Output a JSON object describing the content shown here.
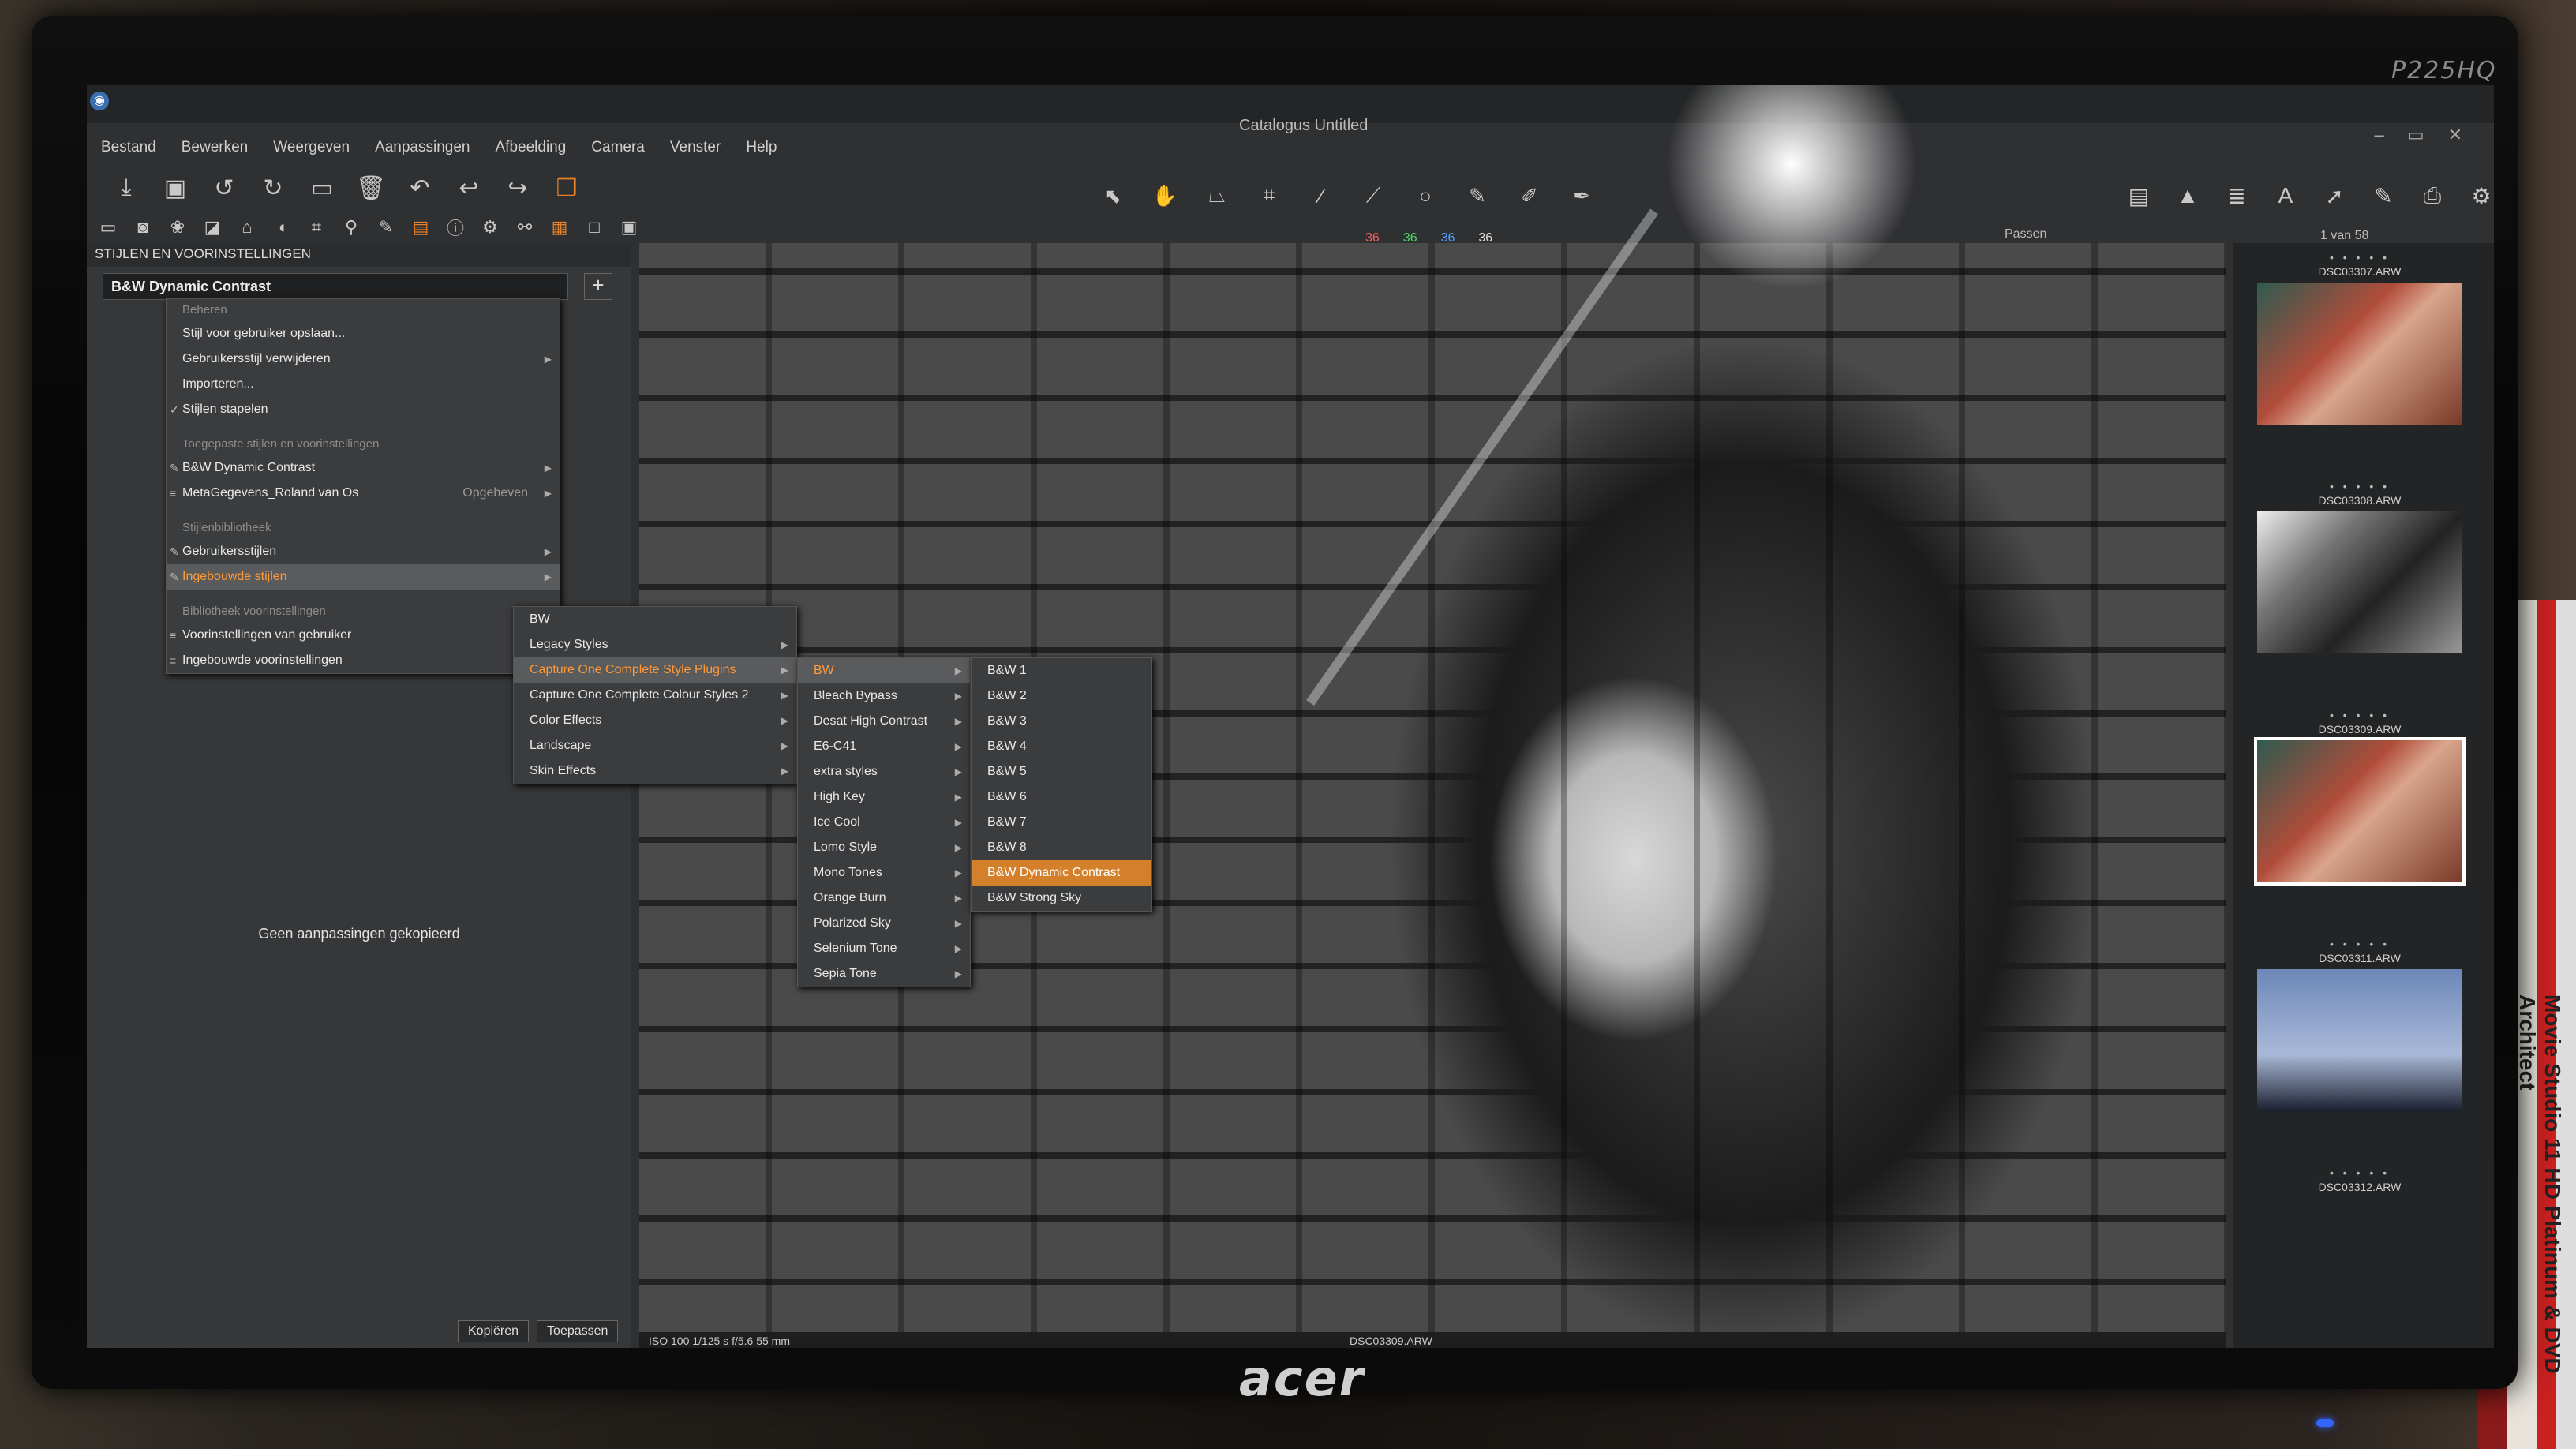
{
  "window": {
    "title": "Catalogus Untitled",
    "controls": [
      "–",
      "▭",
      "✕"
    ]
  },
  "menubar": [
    "Bestand",
    "Bewerken",
    "Weergeven",
    "Aanpassingen",
    "Afbeelding",
    "Camera",
    "Venster",
    "Help"
  ],
  "counts": {
    "red": "36",
    "green": "36",
    "blue": "36",
    "white": "36"
  },
  "passen_label": "Passen",
  "image_count": "1 van 58",
  "left_panel": {
    "header": "STIJLEN EN VOORINSTELLINGEN",
    "selected_style": "B&W Dynamic Contrast",
    "no_adjustments": "Geen aanpassingen gekopieerd",
    "copy_button": "Kopiëren",
    "apply_button": "Toepassen"
  },
  "menu1": {
    "section_manage": "Beheren",
    "save_style": "Stijl voor gebruiker opslaan...",
    "delete_style": "Gebruikersstijl verwijderen",
    "import": "Importeren...",
    "stack_styles": "Stijlen stapelen",
    "section_applied": "Toegepaste stijlen en voorinstellingen",
    "applied_1": "B&W Dynamic Contrast",
    "applied_2": "MetaGegevens_Roland van Os",
    "applied_2_suffix": "Opgeheven",
    "section_library": "Stijlenbibliotheek",
    "user_styles": "Gebruikersstijlen",
    "builtin_styles": "Ingebouwde stijlen",
    "section_presets": "Bibliotheek voorinstellingen",
    "user_presets": "Voorinstellingen van gebruiker",
    "builtin_presets": "Ingebouwde voorinstellingen"
  },
  "menu2": [
    "BW",
    "Legacy Styles",
    "Capture One Complete Style Plugins",
    "Capture One Complete Colour Styles 2",
    "Color Effects",
    "Landscape",
    "Skin Effects"
  ],
  "menu3": [
    "BW",
    "Bleach Bypass",
    "Desat High Contrast",
    "E6-C41",
    "extra styles",
    "High Key",
    "Ice Cool",
    "Lomo Style",
    "Mono Tones",
    "Orange Burn",
    "Polarized Sky",
    "Selenium Tone",
    "Sepia Tone"
  ],
  "menu4": [
    "B&W 1",
    "B&W 2",
    "B&W 3",
    "B&W 4",
    "B&W 5",
    "B&W 6",
    "B&W 7",
    "B&W 8",
    "B&W Dynamic Contrast",
    "B&W Strong Sky"
  ],
  "viewer": {
    "exif": "ISO 100 1/125 s f/5.6 55 mm",
    "filename": "DSC03309.ARW"
  },
  "browser": {
    "thumbs": [
      {
        "name": "DSC03307.ARW",
        "stars": "• • • • •"
      },
      {
        "name": "DSC03308.ARW",
        "stars": "• • • • •"
      },
      {
        "name": "DSC03309.ARW",
        "stars": "• • • • •"
      },
      {
        "name": "DSC03311.ARW",
        "stars": "• • • • •"
      },
      {
        "name": "DSC03312.ARW",
        "stars": "• • • • •"
      }
    ]
  },
  "monitor": {
    "model": "P225HQ",
    "brand": "acer"
  },
  "book_spine": "Movie Studio 11 HD Platinum & DVD Architect"
}
